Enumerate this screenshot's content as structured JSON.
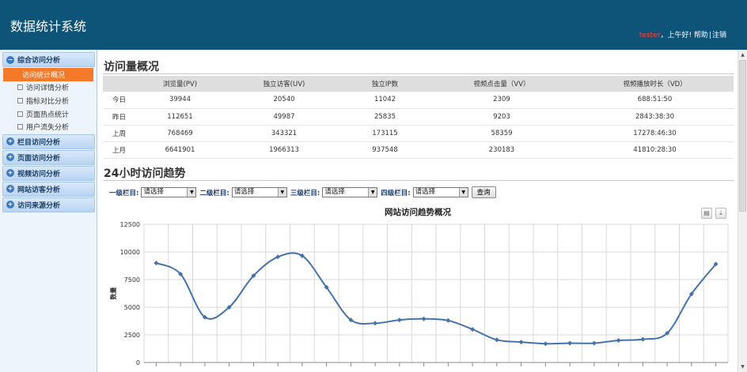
{
  "header": {
    "title": "数据统计系统",
    "user": "tester",
    "greeting": "，上午好!",
    "help": "帮助",
    "separator": "|",
    "logout": "注销"
  },
  "sidebar": {
    "groups": [
      {
        "label": "综合访问分析",
        "icon": "minus-circle-icon",
        "expanded": true,
        "items": [
          {
            "label": "访问统计概况",
            "active": true
          },
          {
            "label": "访问详情分析"
          },
          {
            "label": "指标对比分析"
          },
          {
            "label": "页面热点统计"
          },
          {
            "label": "用户流失分析"
          }
        ]
      },
      {
        "label": "栏目访问分析",
        "icon": "plus-circle-icon"
      },
      {
        "label": "页面访问分析",
        "icon": "plus-circle-icon"
      },
      {
        "label": "视频访问分析",
        "icon": "plus-circle-icon"
      },
      {
        "label": "网站访客分析",
        "icon": "plus-circle-icon"
      },
      {
        "label": "访问来源分析",
        "icon": "plus-circle-icon"
      }
    ]
  },
  "overview": {
    "title": "访问量概况",
    "columns": [
      "",
      "浏览量(PV)",
      "独立访客(UV)",
      "独立IP数",
      "视频点击量（VV）",
      "视频播放时长（VD）"
    ],
    "rows": [
      [
        "今日",
        "39944",
        "20540",
        "11042",
        "2309",
        "688:51:50"
      ],
      [
        "昨日",
        "112651",
        "49987",
        "25835",
        "9203",
        "2843:38:30"
      ],
      [
        "上周",
        "768469",
        "343321",
        "173115",
        "58359",
        "17278:46:30"
      ],
      [
        "上月",
        "6641901",
        "1966313",
        "937548",
        "230183",
        "41810:28:30"
      ]
    ]
  },
  "trend": {
    "title": "24小时访问趋势",
    "filters": [
      {
        "label": "一级栏目:",
        "value": "请选择"
      },
      {
        "label": "二级栏目:",
        "value": "请选择"
      },
      {
        "label": "三级栏目:",
        "value": "请选择"
      },
      {
        "label": "四级栏目:",
        "value": "请选择"
      }
    ],
    "query_label": "查询",
    "print_icon": "printer-icon",
    "download_icon": "download-icon"
  },
  "chart_data": {
    "type": "line",
    "title": "网站访问趋势概况",
    "ylabel": "数量",
    "xlabel": "",
    "ylim": [
      0,
      12500
    ],
    "yticks": [
      0,
      2500,
      5000,
      7500,
      10000,
      12500
    ],
    "grid": true,
    "series": [
      {
        "color": "#4572a7",
        "values": [
          9000,
          8000,
          4100,
          5000,
          7850,
          9550,
          9650,
          6800,
          3850,
          3550,
          3850,
          3950,
          3800,
          3000,
          2050,
          1850,
          1700,
          1750,
          1750,
          2000,
          2100,
          2650,
          6200,
          8900
        ]
      }
    ]
  }
}
